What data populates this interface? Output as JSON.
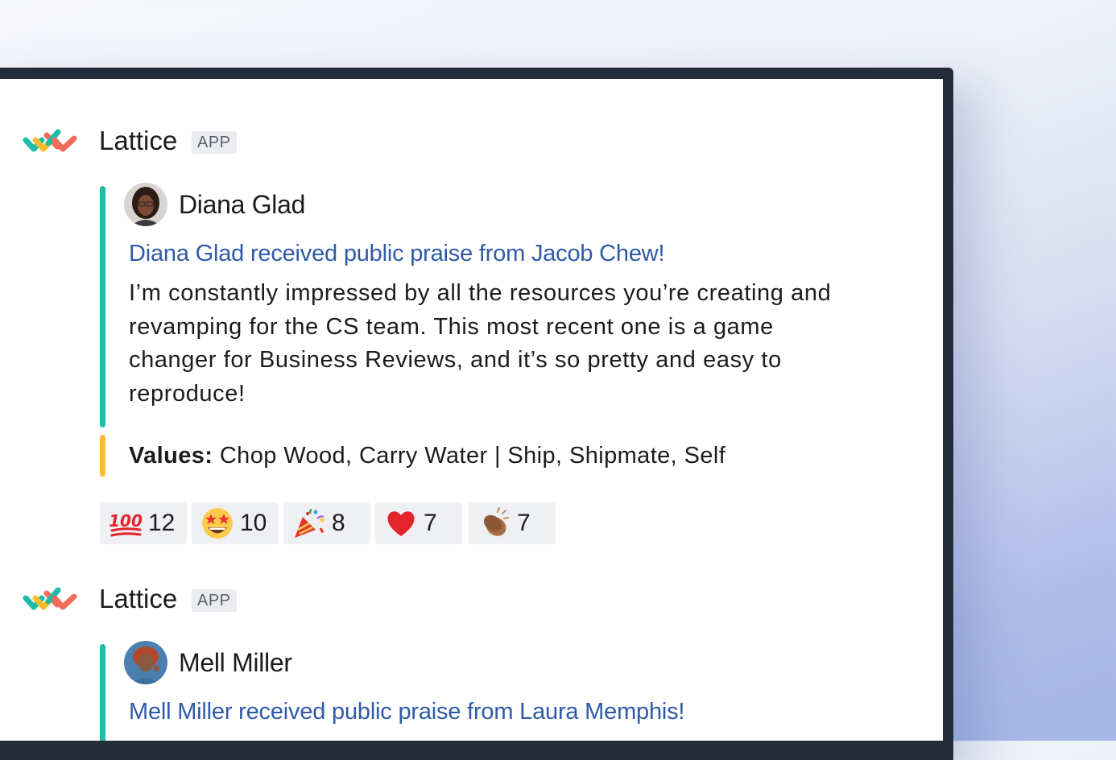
{
  "messages": [
    {
      "app": {
        "name": "Lattice",
        "badge": "APP"
      },
      "person": "Diana Glad",
      "headline": "Diana Glad received public praise from Jacob Chew!",
      "body": "I’m constantly impressed by all the resources you’re creating and revamping for the CS team. This most recent one is a game changer for Business Reviews, and it’s so pretty and easy to reproduce!",
      "values_label": "Values:",
      "values_text": " Chop Wood, Carry Water | Ship, Shipmate, Self",
      "reactions": [
        {
          "icon": "hundred-points-icon",
          "count": "12"
        },
        {
          "icon": "star-struck-face-icon",
          "count": "10"
        },
        {
          "icon": "party-popper-icon",
          "count": "8"
        },
        {
          "icon": "red-heart-icon",
          "count": "7"
        },
        {
          "icon": "clapping-hands-icon",
          "count": "7"
        }
      ]
    },
    {
      "app": {
        "name": "Lattice",
        "badge": "APP"
      },
      "person": "Mell Miller",
      "headline": "Mell Miller received public praise from Laura Memphis!"
    }
  ],
  "colors": {
    "accent_bar": "#1fbba6",
    "values_bar": "#fbbd2e",
    "link": "#2f5aa8",
    "frame": "#232c39"
  }
}
